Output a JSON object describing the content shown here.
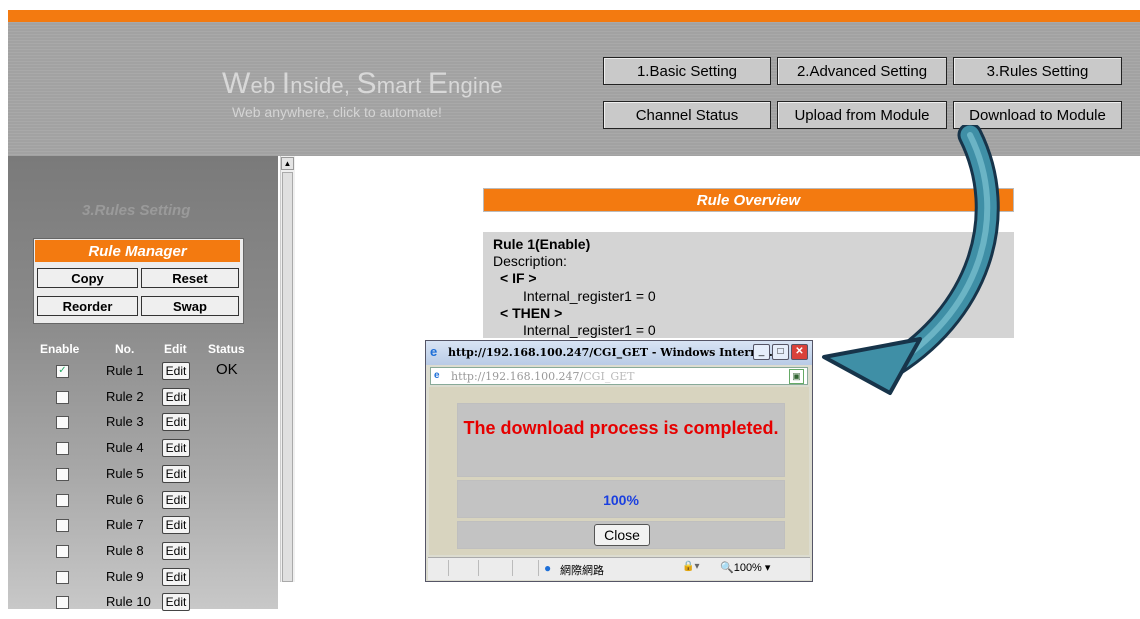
{
  "header": {
    "title_parts": [
      "W",
      "eb ",
      "I",
      "nside, ",
      "S",
      "mart ",
      "E",
      "ngine"
    ],
    "subtitle": "Web anywhere, click to automate!",
    "buttons_row1": [
      "1.Basic Setting",
      "2.Advanced Setting",
      "3.Rules Setting"
    ],
    "buttons_row2": [
      "Channel Status",
      "Upload from Module",
      "Download to Module"
    ]
  },
  "sidebar": {
    "section_title": "3.Rules Setting",
    "rule_manager": {
      "title": "Rule Manager",
      "copy": "Copy",
      "reset": "Reset",
      "reorder": "Reorder",
      "swap": "Swap"
    },
    "columns": {
      "enable": "Enable",
      "no": "No.",
      "edit": "Edit",
      "status": "Status"
    },
    "rules": [
      {
        "label": "Rule 1",
        "checked": true,
        "status": "OK"
      },
      {
        "label": "Rule 2",
        "checked": false,
        "status": ""
      },
      {
        "label": "Rule 3",
        "checked": false,
        "status": ""
      },
      {
        "label": "Rule 4",
        "checked": false,
        "status": ""
      },
      {
        "label": "Rule 5",
        "checked": false,
        "status": ""
      },
      {
        "label": "Rule 6",
        "checked": false,
        "status": ""
      },
      {
        "label": "Rule 7",
        "checked": false,
        "status": ""
      },
      {
        "label": "Rule 8",
        "checked": false,
        "status": ""
      },
      {
        "label": "Rule 9",
        "checked": false,
        "status": ""
      },
      {
        "label": "Rule 10",
        "checked": false,
        "status": ""
      }
    ],
    "edit_label": "Edit",
    "check_glyph": "✓"
  },
  "overview": {
    "header": "Rule Overview",
    "rule_title": "Rule 1(Enable)",
    "description_label": "Description:",
    "if_label": "< IF >",
    "if_condition": "Internal_register1 = 0",
    "then_label": "< THEN >",
    "then_action": "Internal_register1 = 0"
  },
  "popup": {
    "title": "http://192.168.100.247/CGI_GET - Windows Interne...",
    "url_host": "http://192.168.100.247/",
    "url_path": "CGI_GET",
    "message": "The download process is completed.",
    "progress_text": "100%",
    "progress": 1.0,
    "close_label": "Close",
    "status_zone": "網際網路",
    "zoom": "100%"
  },
  "colors": {
    "accent": "#f37a10",
    "arrow": "#3f8fa6",
    "message": "#e60000",
    "progress": "#1a3fe0"
  },
  "icons": {
    "arrow": "curved-arrow-icon",
    "ie": "ie-icon",
    "globe": "globe-icon"
  }
}
